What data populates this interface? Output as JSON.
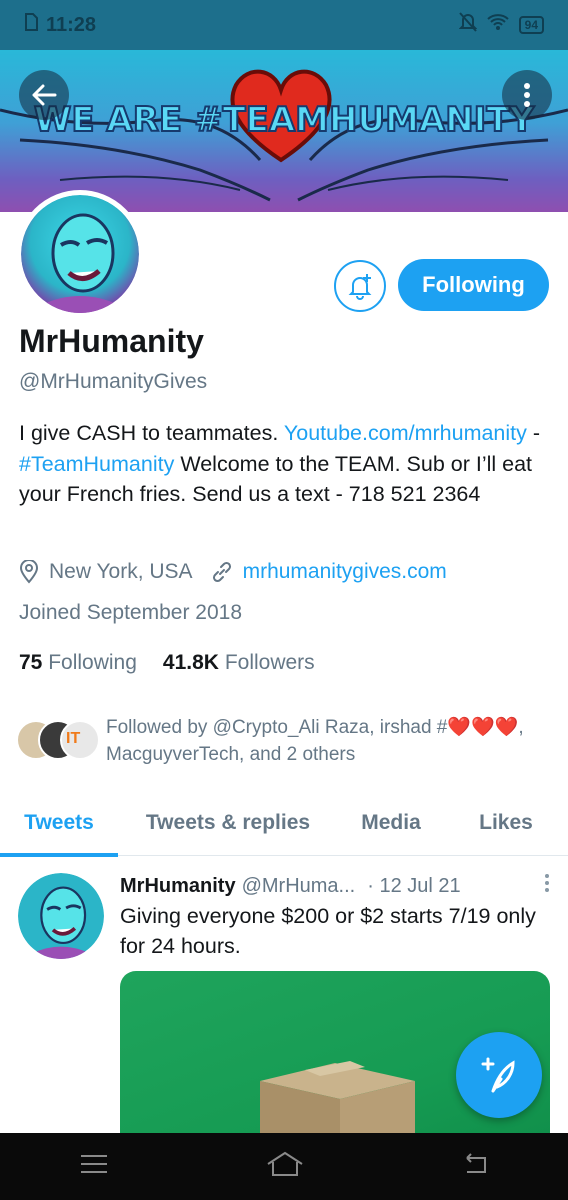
{
  "status_bar": {
    "time": "11:28",
    "battery": "94"
  },
  "banner": {
    "title": "WE ARE #TEAMHUMANITY"
  },
  "profile": {
    "following_label": "Following",
    "name": "MrHumanity",
    "handle": "@MrHumanityGives",
    "bio": {
      "part1": "I give CASH to teammates. ",
      "link1": "Youtube.com/​mrhumanity",
      "part2": " - ",
      "hashtag": "#TeamHumanity",
      "part3": " Welcome to the TEAM. Sub or I’ll eat your French fries. Send us a text - 718 521 2364"
    },
    "location": "New York, USA",
    "website": "mrhumanitygives.com",
    "joined": "Joined September 2018",
    "following_count": "75",
    "following_text": "Following",
    "followers_count": "41.8K",
    "followers_text": "Followers",
    "followed_by": "Followed by @Crypto_Ali Raza, irshad #❤️❤️❤️, MacguyverTech, and 2 others"
  },
  "tabs": [
    "Tweets",
    "Tweets & replies",
    "Media",
    "Likes"
  ],
  "tweet": {
    "name": "MrHumanity",
    "handle": "@MrHuma...",
    "date": "· 12 Jul 21",
    "text": "Giving everyone $200 or $2 starts 7/19 only for 24 hours."
  },
  "colors": {
    "accent": "#1da1f2",
    "status_bar": "#1d6f8c"
  }
}
